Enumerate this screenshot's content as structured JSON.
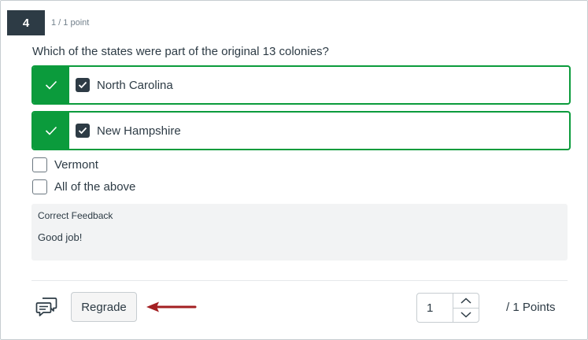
{
  "question": {
    "number": "4",
    "score": "1 / 1 point",
    "text": "Which of the states were part of the original 13 colonies?"
  },
  "answers": [
    {
      "label": "North Carolina",
      "selected": true,
      "correct": true
    },
    {
      "label": "New Hampshire",
      "selected": true,
      "correct": true
    },
    {
      "label": "Vermont",
      "selected": false,
      "correct": false
    },
    {
      "label": "All of the above",
      "selected": false,
      "correct": false
    }
  ],
  "feedback": {
    "title": "Correct Feedback",
    "body": "Good job!"
  },
  "footer": {
    "regrade_label": "Regrade",
    "points_value": "1",
    "points_suffix": "/ 1 Points"
  },
  "icons": {
    "comment": "comment-icon",
    "check": "check-icon",
    "arrow": "arrow-left-icon"
  },
  "colors": {
    "correct_green": "#0b9b3c",
    "dark_navy": "#2d3b45",
    "arrow_red": "#a31f22"
  }
}
